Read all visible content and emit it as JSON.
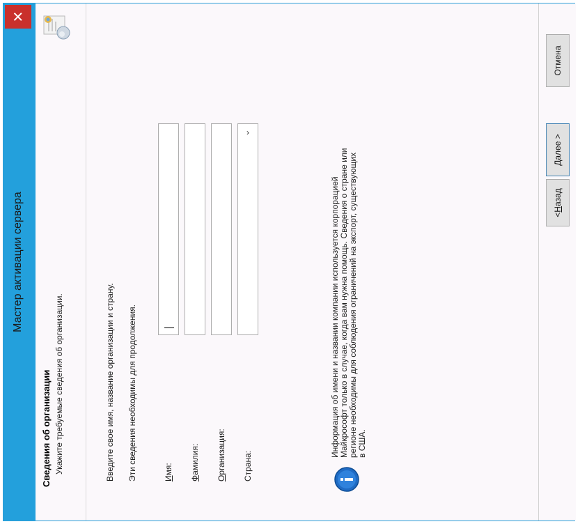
{
  "window": {
    "title": "Мастер активации сервера"
  },
  "header": {
    "title": "Сведения об организации",
    "subtitle": "Укажите требуемые сведения об организации."
  },
  "intro": {
    "line1": "Введите свое имя, название организации и страну.",
    "line2": "Эти сведения необходимы для продолжения."
  },
  "fields": [
    {
      "label_ul": "И",
      "label_rest": "мя:",
      "value": ""
    },
    {
      "label_ul": "Ф",
      "label_rest": "амилия:",
      "value": ""
    },
    {
      "label_ul": "О",
      "label_rest": "рганизация:",
      "value": ""
    },
    {
      "label_ul": "",
      "label_rest": "Страна:",
      "value": ""
    }
  ],
  "info": {
    "line1": "Информация об имени и названии компании используется корпорацией",
    "line2": "Майкрософт только в случае, когда вам нужна помощь. Сведения о стране или",
    "line3": "регионе необходимы для соблюдения ограничений на экспорт, существующих",
    "line4": "в США."
  },
  "buttons": {
    "back_prefix": "< ",
    "back_ul": "Н",
    "back_rest": "азад",
    "next_ul": "Д",
    "next_rest": "алее >",
    "cancel": "Отмена"
  },
  "icons": [
    "close-icon",
    "certificate-icon",
    "info-icon",
    "chevron-down-icon"
  ],
  "colors": {
    "titlebar": "#23a0dc",
    "close": "#c9302c",
    "info": "#1f6bc4"
  }
}
